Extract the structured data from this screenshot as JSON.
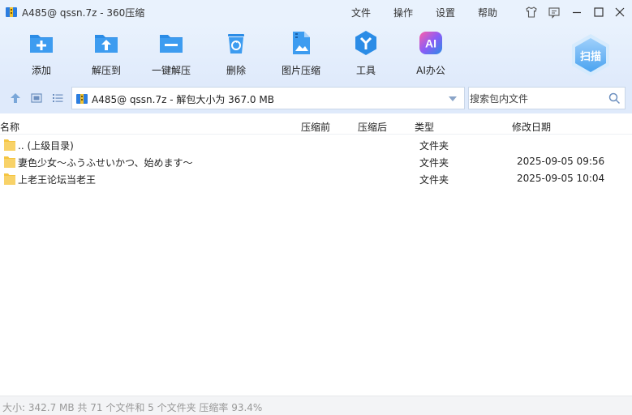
{
  "window": {
    "title": "A485@ qssn.7z - 360压缩",
    "menu": [
      "文件",
      "操作",
      "设置",
      "帮助"
    ]
  },
  "toolbar": {
    "buttons": [
      {
        "label": "添加",
        "icon": "add-icon"
      },
      {
        "label": "解压到",
        "icon": "extract-to-icon"
      },
      {
        "label": "一键解压",
        "icon": "one-click-extract-icon"
      },
      {
        "label": "删除",
        "icon": "delete-icon"
      },
      {
        "label": "图片压缩",
        "icon": "image-compress-icon"
      },
      {
        "label": "工具",
        "icon": "tools-icon"
      },
      {
        "label": "AI办公",
        "icon": "ai-office-icon"
      }
    ],
    "scan_label": "扫描"
  },
  "address": {
    "path": "A485@ qssn.7z - 解包大小为 367.0 MB",
    "search_placeholder": "搜索包内文件"
  },
  "list": {
    "columns": [
      "名称",
      "压缩前",
      "压缩后",
      "类型",
      "修改日期"
    ],
    "rows": [
      {
        "name": ".. (上级目录)",
        "before": "",
        "after": "",
        "type": "文件夹",
        "modified": ""
      },
      {
        "name": "妻色少女～ふうふせいかつ、始めます～",
        "before": "",
        "after": "",
        "type": "文件夹",
        "modified": "2025-09-05 09:56"
      },
      {
        "name": "上老王论坛当老王",
        "before": "",
        "after": "",
        "type": "文件夹",
        "modified": "2025-09-05 10:04"
      }
    ]
  },
  "status": {
    "text": "大小: 342.7 MB 共 71 个文件和 5 个文件夹 压缩率 93.4%"
  },
  "colors": {
    "accent": "#2b8ce6",
    "folder": "#f5c542",
    "toolbar_bg": "#e9f2fd"
  }
}
